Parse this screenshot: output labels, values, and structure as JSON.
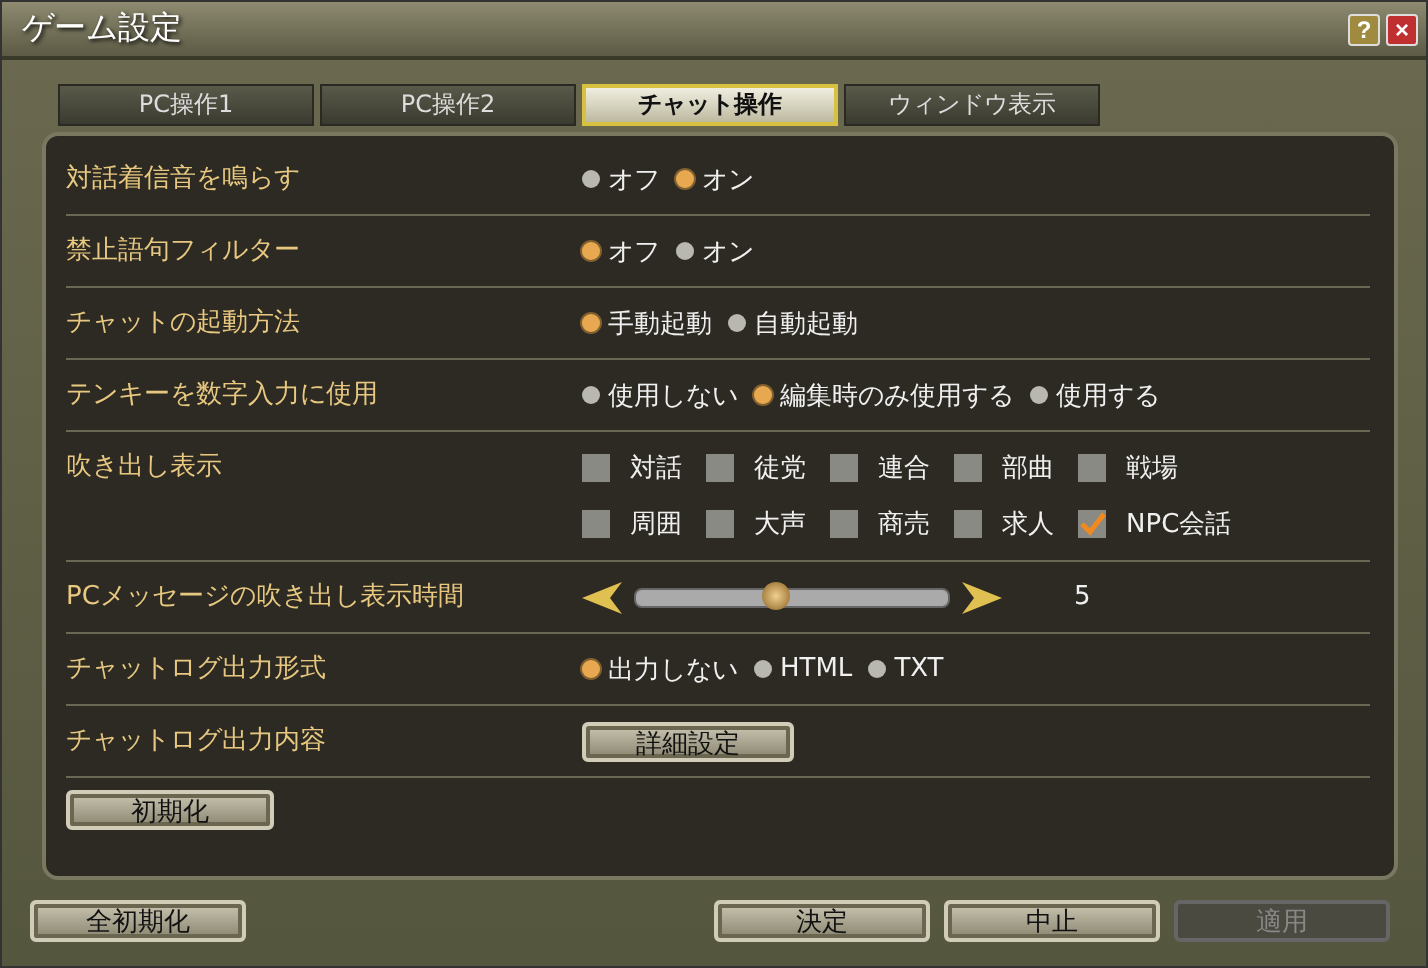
{
  "window": {
    "title": "ゲーム設定",
    "help": "?",
    "close": "×"
  },
  "tabs": [
    {
      "label": "PC操作1",
      "selected": false
    },
    {
      "label": "PC操作2",
      "selected": false
    },
    {
      "label": "チャット操作",
      "selected": true
    },
    {
      "label": "ウィンドウ表示",
      "selected": false
    }
  ],
  "rows": [
    {
      "kind": "radio",
      "label": "対話着信音を鳴らす",
      "options": [
        {
          "label": "オフ",
          "selected": false
        },
        {
          "label": "オン",
          "selected": true
        }
      ]
    },
    {
      "kind": "radio",
      "label": "禁止語句フィルター",
      "options": [
        {
          "label": "オフ",
          "selected": true
        },
        {
          "label": "オン",
          "selected": false
        }
      ]
    },
    {
      "kind": "radio",
      "label": "チャットの起動方法",
      "options": [
        {
          "label": "手動起動",
          "selected": true
        },
        {
          "label": "自動起動",
          "selected": false
        }
      ]
    },
    {
      "kind": "radio",
      "label": "テンキーを数字入力に使用",
      "options": [
        {
          "label": "使用しない",
          "selected": false
        },
        {
          "label": "編集時のみ使用する",
          "selected": true
        },
        {
          "label": "使用する",
          "selected": false
        }
      ]
    },
    {
      "kind": "checkbox",
      "label": "吹き出し表示",
      "options": [
        {
          "label": "対話",
          "checked": false
        },
        {
          "label": "徒党",
          "checked": false
        },
        {
          "label": "連合",
          "checked": false
        },
        {
          "label": "部曲",
          "checked": false
        },
        {
          "label": "戦場",
          "checked": false
        },
        {
          "label": "周囲",
          "checked": false
        },
        {
          "label": "大声",
          "checked": false
        },
        {
          "label": "商売",
          "checked": false
        },
        {
          "label": "求人",
          "checked": false
        },
        {
          "label": "NPC会話",
          "checked": true
        }
      ]
    },
    {
      "kind": "slider",
      "label": "PCメッセージの吹き出し表示時間",
      "level": 0.45,
      "reading": "5"
    },
    {
      "kind": "radio",
      "label": "チャットログ出力形式",
      "options": [
        {
          "label": "出力しない",
          "selected": true
        },
        {
          "label": "HTML",
          "selected": false
        },
        {
          "label": "TXT",
          "selected": false
        }
      ]
    },
    {
      "kind": "button",
      "label": "チャットログ出力内容",
      "button": "詳細設定"
    }
  ],
  "reset_button": "初期化",
  "footer": {
    "reset_all": "全初期化",
    "buttons": [
      {
        "label": "決定",
        "disabled": false
      },
      {
        "label": "中止",
        "disabled": false
      },
      {
        "label": "適用",
        "disabled": true
      }
    ]
  }
}
